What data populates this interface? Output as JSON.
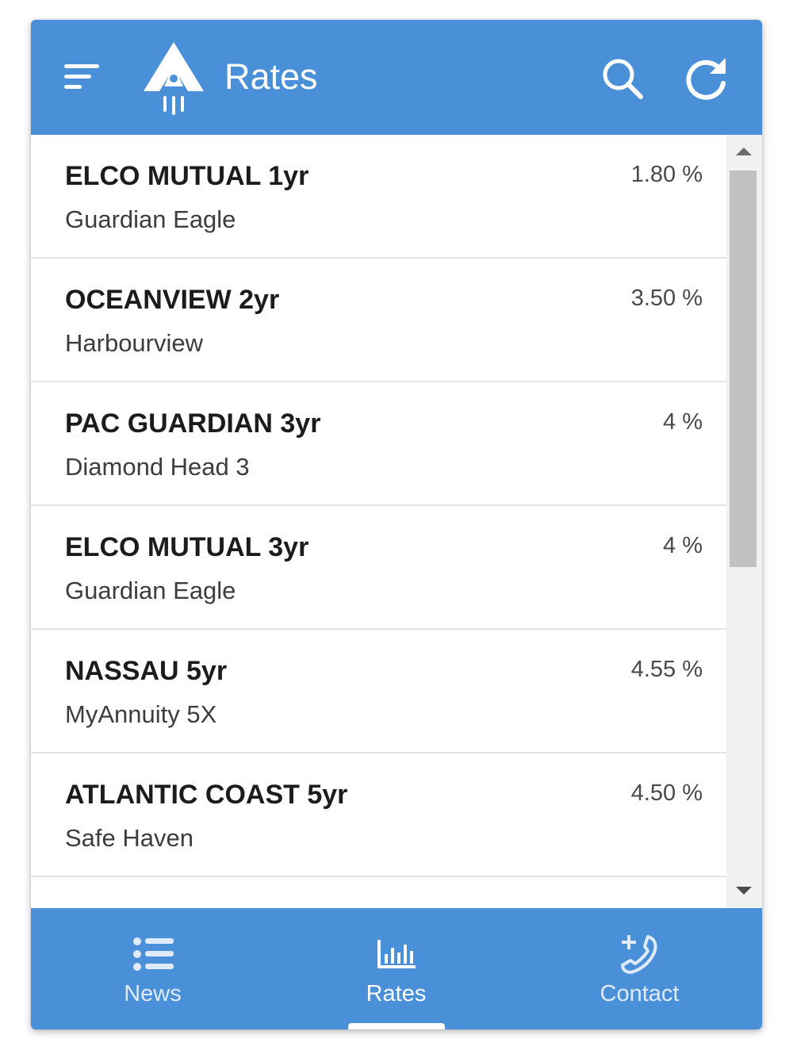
{
  "colors": {
    "primary": "#4a90d9",
    "text_dark": "#1c1c1c",
    "text_sub": "#3d3d3d"
  },
  "header": {
    "title": "Rates",
    "menu_icon": "filter-menu-icon",
    "logo_icon": "rocket-logo-icon",
    "search_icon": "search-icon",
    "refresh_icon": "refresh-icon"
  },
  "rates": [
    {
      "name": "ELCO MUTUAL 1yr",
      "product": "Guardian Eagle",
      "rate": "1.80 %"
    },
    {
      "name": "OCEANVIEW 2yr",
      "product": "Harbourview",
      "rate": "3.50 %"
    },
    {
      "name": "PAC GUARDIAN 3yr",
      "product": "Diamond Head 3",
      "rate": "4 %"
    },
    {
      "name": "ELCO MUTUAL 3yr",
      "product": "Guardian Eagle",
      "rate": "4 %"
    },
    {
      "name": "NASSAU 5yr",
      "product": "MyAnnuity 5X",
      "rate": "4.55 %"
    },
    {
      "name": "ATLANTIC COAST 5yr",
      "product": "Safe Haven",
      "rate": "4.50 %"
    }
  ],
  "bottom_nav": {
    "tabs": [
      {
        "label": "News",
        "icon": "list-icon"
      },
      {
        "label": "Rates",
        "icon": "bar-chart-icon",
        "active": true
      },
      {
        "label": "Contact",
        "icon": "phone-add-icon"
      }
    ]
  }
}
